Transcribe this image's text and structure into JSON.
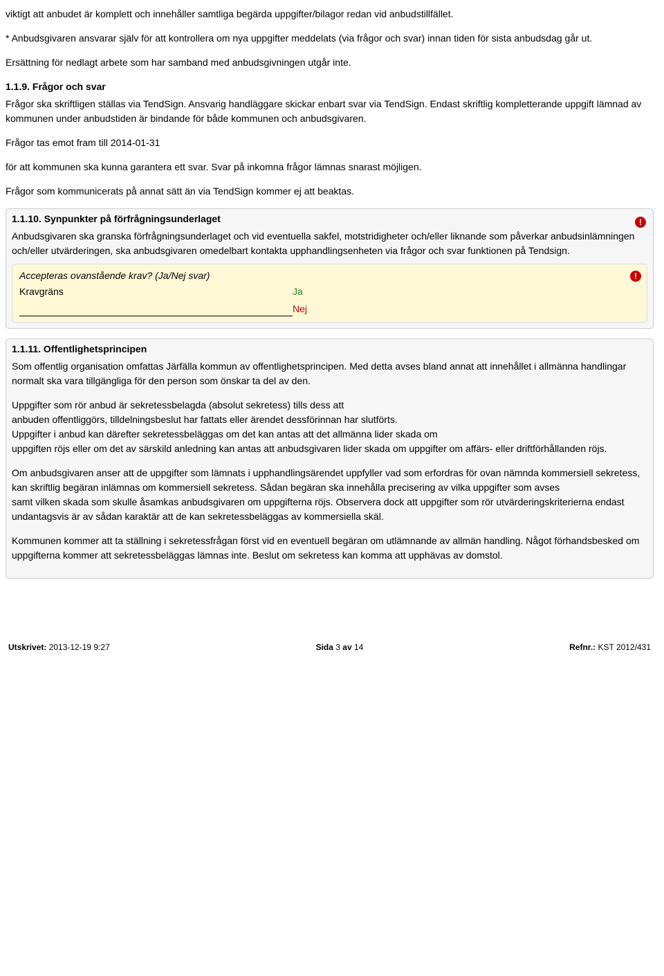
{
  "intro": {
    "p1": "viktigt att anbudet är komplett och innehåller samtliga begärda uppgifter/bilagor redan vid anbudstillfället.",
    "p2": "* Anbudsgivaren ansvarar själv för att kontrollera om nya uppgifter meddelats (via frågor och svar) innan tiden för sista anbudsdag går ut.",
    "p3": "Ersättning för nedlagt arbete som har samband med anbudsgivningen utgår inte."
  },
  "s119": {
    "heading": "1.1.9. Frågor och svar",
    "p1": "Frågor ska skriftligen ställas via TendSign. Ansvarig handläggare skickar enbart svar via TendSign. Endast skriftlig kompletterande uppgift lämnad av kommunen under anbudstiden är bindande för både kommunen och anbudsgivaren.",
    "p2": "Frågor tas emot fram till 2014-01-31",
    "p3": "för att kommunen ska kunna garantera ett svar. Svar på inkomna frågor lämnas snarast möjligen.",
    "p4": " Frågor som kommunicerats på annat sätt än via TendSign kommer ej att beaktas."
  },
  "s1110": {
    "heading": "1.1.10. Synpunkter på förfrågningsunderlaget",
    "body": "Anbudsgivaren ska granska förfrågningsunderlaget och vid eventuella sakfel, motstridigheter och/eller liknande som påverkar anbudsinlämningen och/eller utvärderingen, ska anbudsgivaren omedelbart kontakta upphandlingsenheten via frågor och svar funktionen på Tendsign.",
    "krav_q": "Accepteras ovanstående krav? (Ja/Nej svar)",
    "krav_label": "Kravgräns",
    "ja": "Ja",
    "nej": "Nej"
  },
  "s1111": {
    "heading": "1.1.11. Offentlighetsprincipen",
    "p1": "Som offentlig organisation omfattas Järfälla kommun av offentlighetsprincipen. Med detta avses bland annat att innehållet i allmänna handlingar normalt ska vara tillgängliga för den person som önskar ta del av den.",
    "p2a": "Uppgifter som rör anbud är sekretessbelagda (absolut sekretess) tills dess att",
    "p2b": "anbuden offentliggörs, tilldelningsbeslut har fattats eller ärendet dessförinnan har slutförts.",
    "p2c": "Uppgifter i anbud kan därefter sekretessbeläggas om det kan antas att det allmänna lider skada om",
    "p2d": "uppgiften röjs eller om det av särskild anledning kan antas att anbudsgivaren lider skada om uppgifter om affärs- eller driftförhållanden röjs.",
    "p3a": "Om anbudsgivaren anser att de uppgifter som lämnats i upphandlingsärendet uppfyller vad som erfordras för ovan nämnda kommersiell sekretess, kan skriftlig begäran inlämnas om kommersiell sekretess. Sådan begäran ska innehålla precisering av vilka uppgifter som avses",
    "p3b": "samt vilken skada som skulle åsamkas anbudsgivaren om uppgifterna röjs. Observera dock att uppgifter som rör utvärderingskriterierna endast undantagsvis är av sådan karaktär att de kan sekretessbeläggas av kommersiella skäl.",
    "p4": "Kommunen kommer att ta ställning i sekretessfrågan först vid en eventuell begäran om utlämnande av allmän handling. Något förhandsbesked om uppgifterna kommer att sekretessbeläggas lämnas inte. Beslut om sekretess kan komma att upphävas av domstol."
  },
  "footer": {
    "printed_label": "Utskrivet:",
    "printed_value": " 2013-12-19  9:27",
    "page_label": "Sida ",
    "page_num": "3",
    "page_of": " av ",
    "page_total": "14",
    "ref_label": "Refnr.:",
    "ref_value": " KST 2012/431"
  },
  "alert_glyph": "!"
}
